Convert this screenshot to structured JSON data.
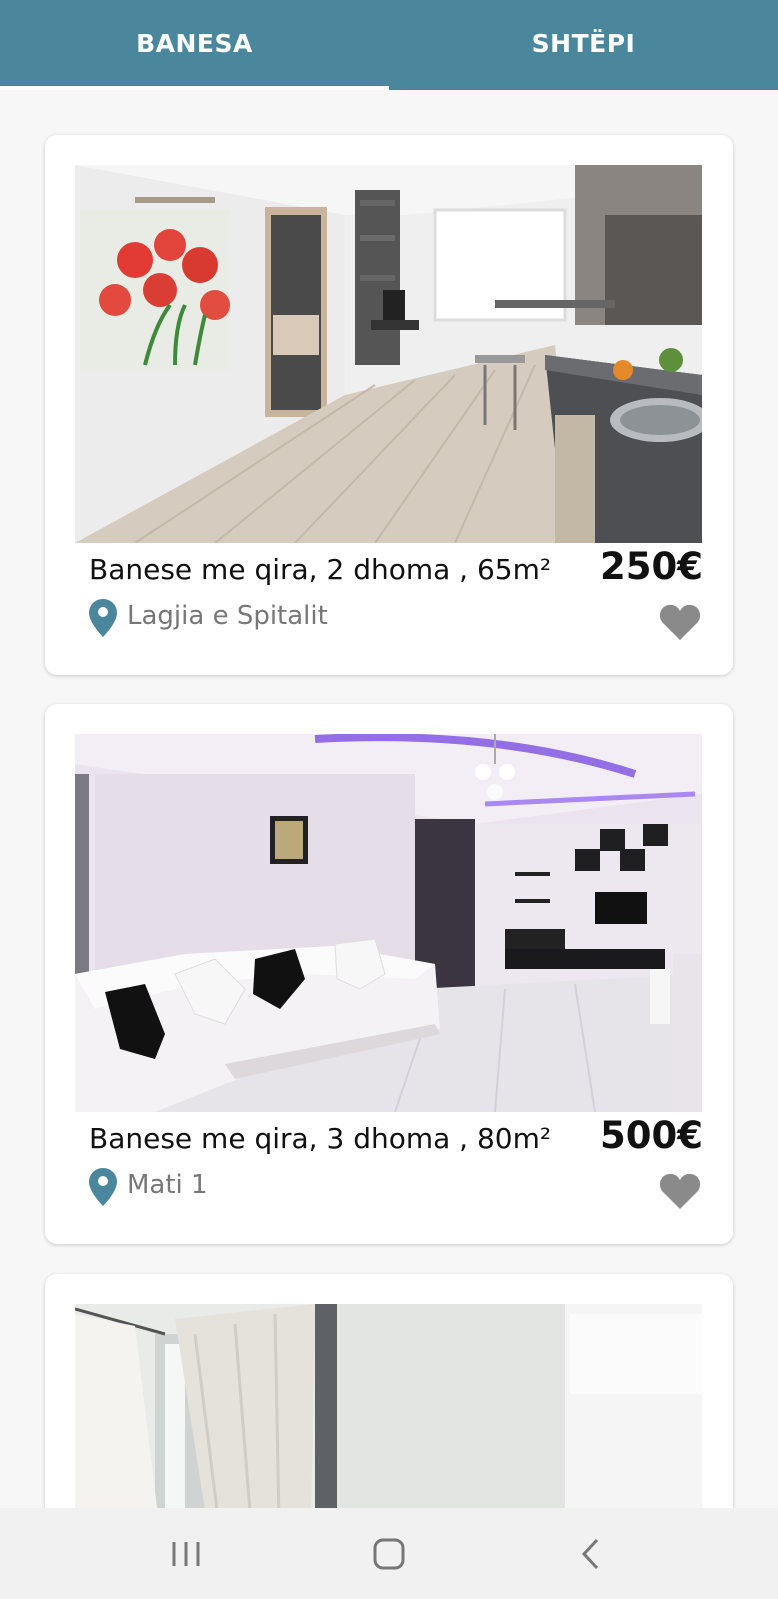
{
  "tabs": [
    {
      "label": "BANESA",
      "selected": true
    },
    {
      "label": "SHTËPI",
      "selected": false
    }
  ],
  "listings": [
    {
      "title": "Banese me qira, 2 dhoma , 65m²",
      "price": "250€",
      "location": "Lagjia e Spitalit",
      "favorite": false,
      "photo": "modern apartment with kitchen and wood floor"
    },
    {
      "title": "Banese me qira, 3 dhoma , 80m²",
      "price": "500€",
      "location": "Mati 1",
      "favorite": false,
      "photo": "living room with white sectional sofa and purple ceiling lights"
    },
    {
      "title": "",
      "price": "",
      "location": "",
      "favorite": false,
      "photo": "room with white curtains and lamp"
    }
  ],
  "navigation": {
    "recent_icon": "recent-apps-icon",
    "home_icon": "home-icon",
    "back_icon": "back-icon"
  },
  "colors": {
    "accent": "#4a879d",
    "heart": "#8a8a8a",
    "pin": "#4a879d"
  }
}
